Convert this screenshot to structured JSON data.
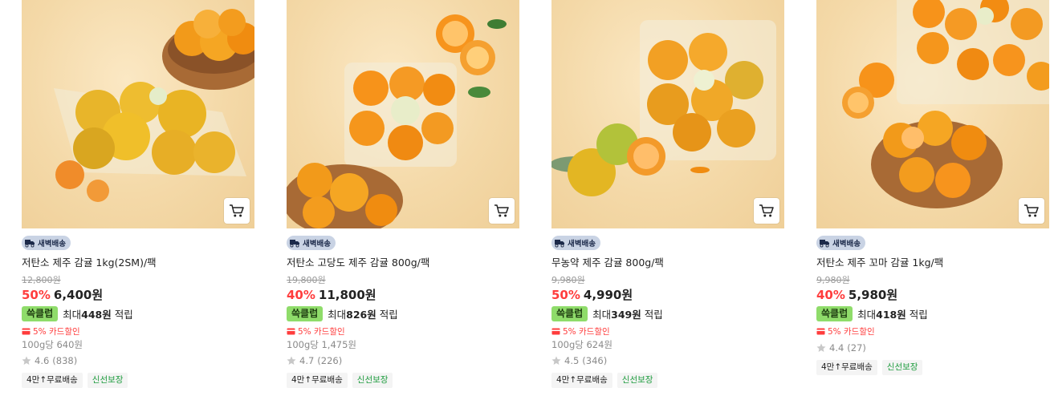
{
  "colors": {
    "discount": "#ff3d3d",
    "ssg_tag_bg": "#8fdc6a",
    "dawn_badge_bg": "#c9d3e4",
    "fresh_tag": "#1e9c3e"
  },
  "products": [
    {
      "badge": "새벽배송",
      "title": "저탄소 제주 감귤 1kg(2SM)/팩",
      "original_price": "12,800원",
      "discount_rate": "50%",
      "sale_price": "6,400원",
      "ssg_tag": "쓱클럽",
      "points_prefix": "최대",
      "points_amount": "448원",
      "points_suffix": "적립",
      "card_discount": "5% 카드할인",
      "unit_price": "100g당 640원",
      "rating": "4.6",
      "review_count": "(838)",
      "tags": [
        "4만↑무료배송",
        "신선보장"
      ]
    },
    {
      "badge": "새벽배송",
      "title": "저탄소 고당도 제주 감귤 800g/팩",
      "original_price": "19,800원",
      "discount_rate": "40%",
      "sale_price": "11,800원",
      "ssg_tag": "쓱클럽",
      "points_prefix": "최대",
      "points_amount": "826원",
      "points_suffix": "적립",
      "card_discount": "5% 카드할인",
      "unit_price": "100g당 1,475원",
      "rating": "4.7",
      "review_count": "(226)",
      "tags": [
        "4만↑무료배송",
        "신선보장"
      ]
    },
    {
      "badge": "새벽배송",
      "title": "무농약 제주 감귤 800g/팩",
      "original_price": "9,980원",
      "discount_rate": "50%",
      "sale_price": "4,990원",
      "ssg_tag": "쓱클럽",
      "points_prefix": "최대",
      "points_amount": "349원",
      "points_suffix": "적립",
      "card_discount": "5% 카드할인",
      "unit_price": "100g당 624원",
      "rating": "4.5",
      "review_count": "(346)",
      "tags": [
        "4만↑무료배송",
        "신선보장"
      ]
    },
    {
      "badge": "새벽배송",
      "title": "저탄소 제주 꼬마 감귤 1kg/팩",
      "original_price": "9,980원",
      "discount_rate": "40%",
      "sale_price": "5,980원",
      "ssg_tag": "쓱클럽",
      "points_prefix": "최대",
      "points_amount": "418원",
      "points_suffix": "적립",
      "card_discount": "5% 카드할인",
      "unit_price": "",
      "rating": "4.4",
      "review_count": "(27)",
      "tags": [
        "4만↑무료배송",
        "신선보장"
      ]
    }
  ],
  "icons": {
    "cart": "cart-icon",
    "truck": "truck-icon",
    "card": "credit-card-icon",
    "star": "star-icon"
  }
}
